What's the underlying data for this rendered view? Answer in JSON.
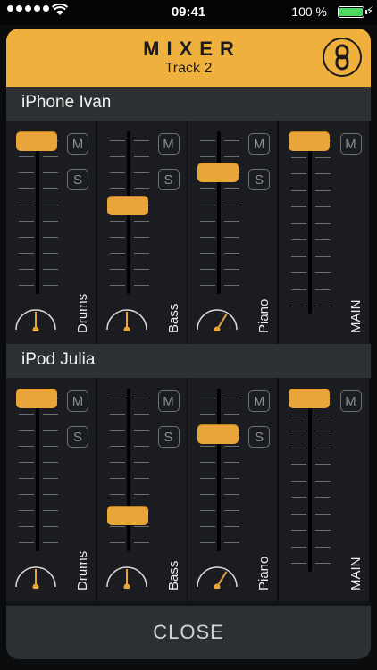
{
  "status": {
    "time": "09:41",
    "battery": "100 %"
  },
  "header": {
    "title": "MIXER",
    "subtitle": "Track 2",
    "link_icon": "chain-link-icon"
  },
  "colors": {
    "accent": "#f0b03d",
    "knob": "#e9a43a",
    "panel": "#1a1c1f"
  },
  "sections": [
    {
      "name": "iPhone Ivan",
      "channels": [
        {
          "label": "Drums",
          "level": 1.0,
          "pan": 0.0,
          "mute": "M",
          "solo": "S"
        },
        {
          "label": "Bass",
          "level": 0.55,
          "pan": 0.0,
          "mute": "M",
          "solo": "S"
        },
        {
          "label": "Piano",
          "level": 0.78,
          "pan": 0.35,
          "mute": "M",
          "solo": "S"
        },
        {
          "label": "MAIN",
          "level": 1.0,
          "mute": "M"
        }
      ]
    },
    {
      "name": "iPod Julia",
      "channels": [
        {
          "label": "Drums",
          "level": 1.0,
          "pan": 0.0,
          "mute": "M",
          "solo": "S"
        },
        {
          "label": "Bass",
          "level": 0.18,
          "pan": 0.0,
          "mute": "M",
          "solo": "S"
        },
        {
          "label": "Piano",
          "level": 0.75,
          "pan": 0.35,
          "mute": "M",
          "solo": "S"
        },
        {
          "label": "MAIN",
          "level": 1.0,
          "mute": "M"
        }
      ]
    }
  ],
  "footer": {
    "close_label": "CLOSE"
  }
}
